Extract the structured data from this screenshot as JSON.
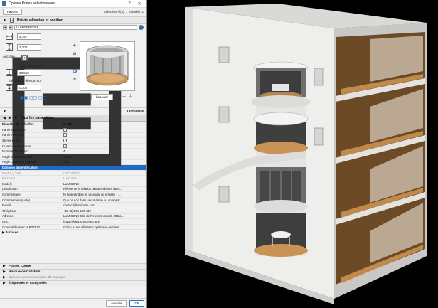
{
  "window": {
    "title": "Options Portes sélectionnées",
    "help": "?",
    "close": "✕"
  },
  "favorites": {
    "button": "Favoris",
    "selection": "Sélectionné(s): 1 Éditable: 1"
  },
  "sections": {
    "preview": "Prévisualisation et position",
    "lumicene": "Lumicene",
    "plan": "Plan et Coupe",
    "cotation": "Marque de Cotation",
    "marque": "Options personnalisées de Marque",
    "etiquettes": "Étiquettes et catégories"
  },
  "id": {
    "value": "LUMICENE001"
  },
  "dims": {
    "width": "5,757",
    "height": "2,300",
    "anchor_label": "Ancrage :",
    "appui_label": "Appui à étage 0",
    "appui_value": "38,560",
    "elevation_label": "Élévation à tête du mur",
    "elevation_value": "0,300",
    "basculer": "basculer"
  },
  "nav": {
    "label": "Tous les paramètres..."
  },
  "params": {
    "header": {
      "name": "Diamètre de la fenêtre",
      "value": "Ø 300"
    },
    "rows": [
      {
        "name": "Partie supérieure",
        "value": "✓",
        "type": "check"
      },
      {
        "name": "Partie inférieure",
        "value": "✓",
        "type": "check"
      },
      {
        "name": "Stores en 3D",
        "value": "✓",
        "type": "check"
      },
      {
        "name": "Ouverture des stores",
        "value": "✓",
        "type": "check"
      },
      {
        "name": "Nombre de vantaux",
        "value": "4",
        "type": "text"
      },
      {
        "name": "Angle d'ouverture Droit",
        "value": "-90,00°",
        "type": "text"
      },
      {
        "name": "Angle Ouverture Gauche",
        "value": "0,00°",
        "type": "text"
      }
    ],
    "id_section": "Données d'identification",
    "id_rows": [
      {
        "name": "Produit_Code",
        "value": "LMC010001",
        "dim": true
      },
      {
        "name": "Fabricant",
        "value": "Lumicene",
        "dim": true
      },
      {
        "name": "Modèle",
        "value": "LUMICENE",
        "dim": false
      },
      {
        "name": "Description",
        "value": "Réinvente la relation dedans-dehors dans...",
        "dim": false
      },
      {
        "name": "Commentaire",
        "value": "Ni bow window, ni veranda, ni terrasse - ...",
        "dim": false
      },
      {
        "name": "Commentaire (suite)",
        "value": "Que ce soit dans une maison ou un appar...",
        "dim": false
      },
      {
        "name": "E-mail",
        "value": "contact@lumicene.com",
        "dim": false
      },
      {
        "name": "Téléphone",
        "value": "+33 (0)4 01 130 430",
        "dim": false
      },
      {
        "name": "Adresse",
        "value": "LUMICENE Cité de l'environnement, 355 a...",
        "dim": false
      },
      {
        "name": "URL",
        "value": "https://www.lumicene.com/",
        "dim": false
      },
      {
        "name": "Compatible avec la RT2012",
        "value": "Grâce à une utilisation optimisée mettant ...",
        "dim": false
      }
    ],
    "surfaces": "Surfaces"
  },
  "buttons": {
    "cancel": "Annuler",
    "ok": "OK"
  },
  "colors": {
    "accent": "#1e6bc6",
    "wood": "#b07a3d",
    "wall": "#e9e9e7",
    "background": "#000000"
  }
}
